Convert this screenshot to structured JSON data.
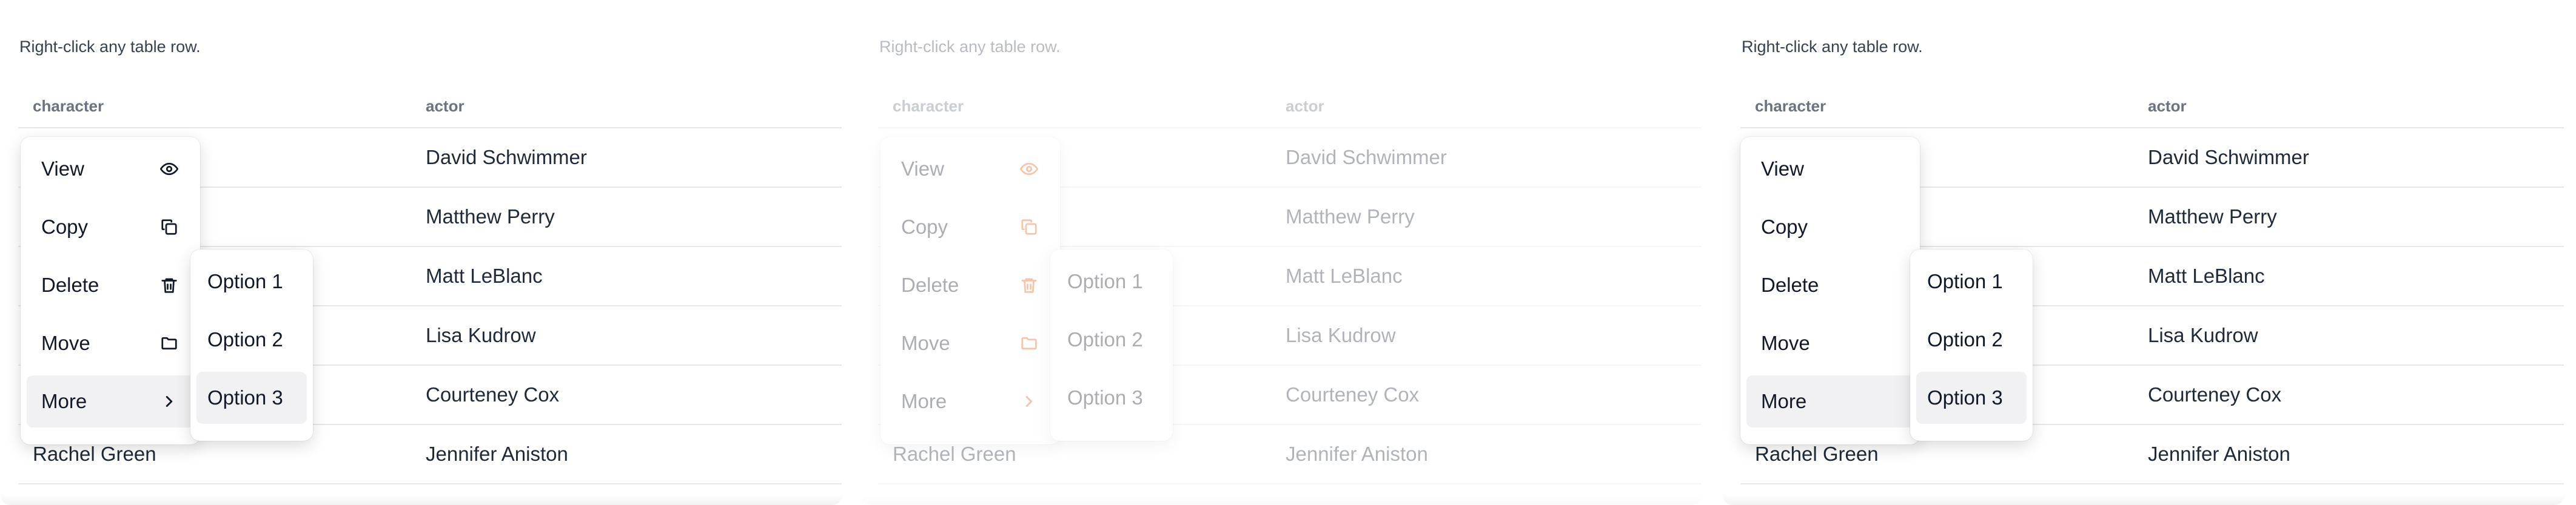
{
  "hint": "Right-click any table row.",
  "columns": {
    "character": "character",
    "actor": "actor"
  },
  "rows": [
    {
      "character": "",
      "actor": "David Schwimmer"
    },
    {
      "character": "",
      "actor": "Matthew Perry"
    },
    {
      "character": "",
      "actor": "Matt LeBlanc"
    },
    {
      "character": "",
      "actor": "Lisa Kudrow"
    },
    {
      "character": "",
      "actor": "Courteney Cox"
    },
    {
      "character": "Rachel Green",
      "actor": "Jennifer Aniston"
    }
  ],
  "context_menu": {
    "items": [
      {
        "label": "View",
        "icon": "eye-icon"
      },
      {
        "label": "Copy",
        "icon": "copy-icon"
      },
      {
        "label": "Delete",
        "icon": "trash-icon"
      },
      {
        "label": "Move",
        "icon": "folder-icon"
      },
      {
        "label": "More",
        "icon": "chevron-right-icon"
      }
    ]
  },
  "submenu": {
    "items": [
      {
        "label": "Option 1"
      },
      {
        "label": "Option 2"
      },
      {
        "label": "Option 3"
      }
    ]
  },
  "colors": {
    "icon_default": "#111827",
    "icon_accent": "#ea580c",
    "hover_bg": "#f1f1f3"
  }
}
